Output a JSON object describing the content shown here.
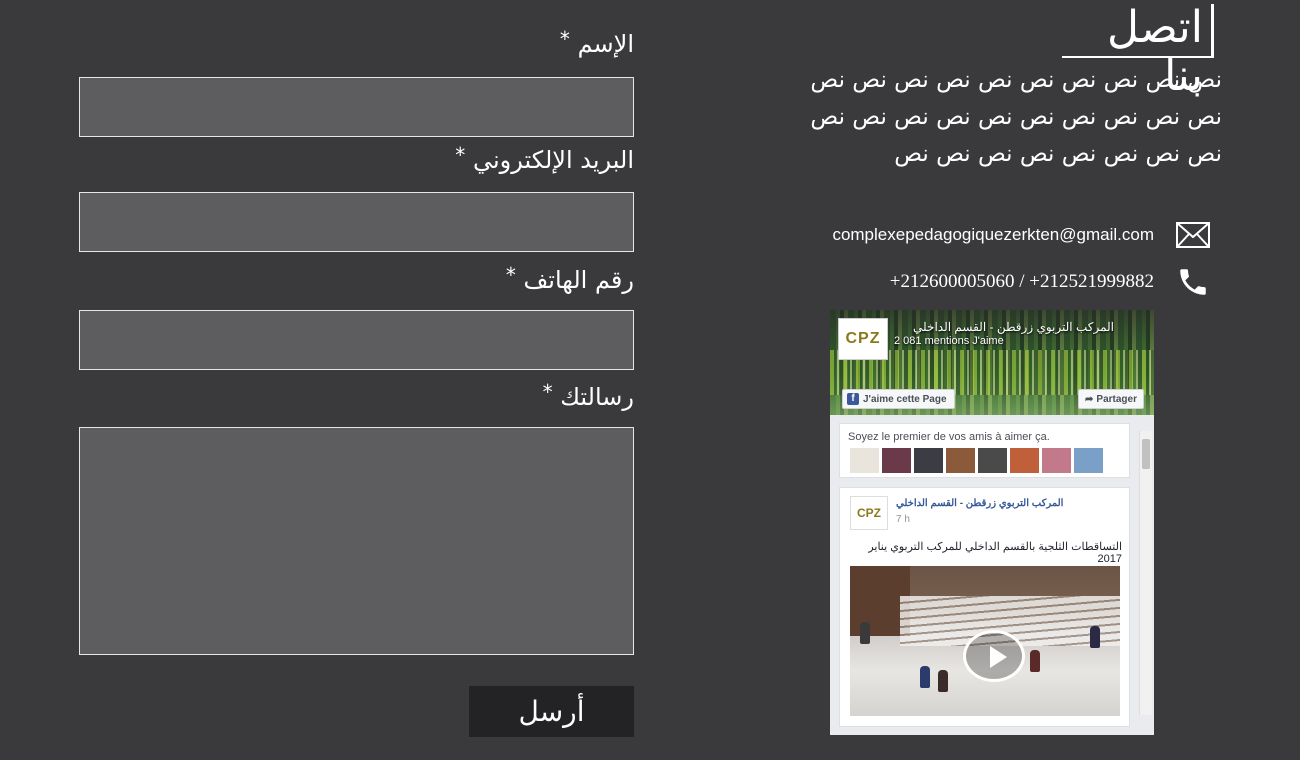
{
  "contact": {
    "title": "اتصل بنا",
    "paragraph": "نص نص نص نص نص نص نص نص نص نص نص نص نص نص نص نص نص نص نص نص نص نص نص نص نص نص نص نص",
    "email": "complexepedagogiquezerkten@gmail.com",
    "phone": "+212600005060 / +212521999882",
    "email_icon": "envelope-icon",
    "phone_icon": "phone-icon"
  },
  "facebook": {
    "page_name": "المركب التربوي زرقطن - القسم الداخلي",
    "likes": "2 081 mentions J'aime",
    "logo_text": "CPZ",
    "like_button": "J'aime cette Page",
    "share_button": "Partager",
    "friends_text": "Soyez le premier de vos amis à aimer ça.",
    "post_author": "المركب التربوي زرقطن - القسم الداخلي",
    "post_time": "7 h",
    "post_text": "التساقطات الثلجية بالقسم الداخلي للمركب التربوي يناير 2017"
  },
  "form": {
    "name_label": "الإسم",
    "email_label": "البريد الإلكتروني",
    "phone_label": "رقم الهاتف",
    "message_label": "رسالتك",
    "required_mark": "*",
    "submit_label": "أرسل",
    "name_value": "",
    "email_value": "",
    "phone_value": "",
    "message_value": ""
  },
  "colors": {
    "background": "#3a393b",
    "input_background": "#5d5c5f",
    "submit_background": "#232224",
    "text": "#ffffff"
  }
}
